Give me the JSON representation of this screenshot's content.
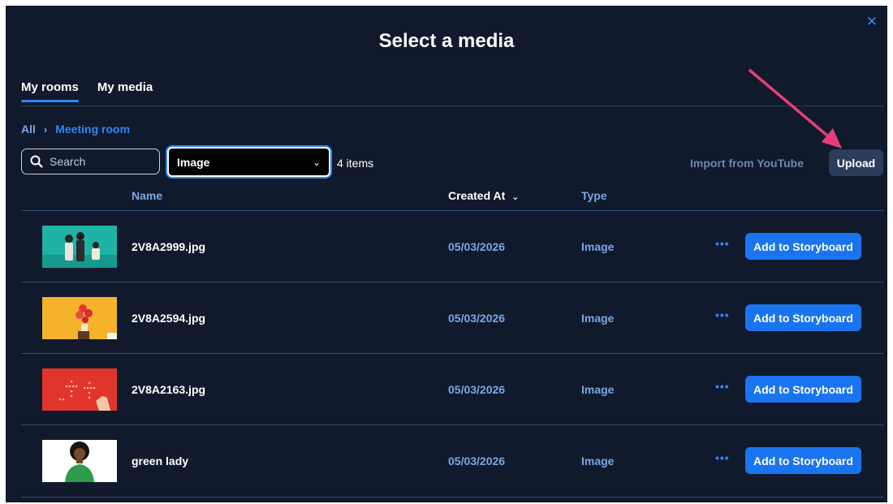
{
  "dialog": {
    "title": "Select a media",
    "close_icon": "close-icon"
  },
  "tabs": [
    {
      "label": "My rooms",
      "active": true
    },
    {
      "label": "My media",
      "active": false
    }
  ],
  "breadcrumb": {
    "root": "All",
    "separator": "›",
    "current": "Meeting room"
  },
  "search": {
    "placeholder": "Search"
  },
  "filter": {
    "selected": "Image"
  },
  "item_count": "4 items",
  "actions": {
    "import_youtube": "Import from YouTube",
    "upload": "Upload"
  },
  "table": {
    "columns": {
      "name": "Name",
      "created": "Created At",
      "type": "Type"
    },
    "rows": [
      {
        "name": "2V8A2999.jpg",
        "date": "05/03/2026",
        "type": "Image",
        "more": "•••",
        "action": "Add to Storyboard"
      },
      {
        "name": "2V8A2594.jpg",
        "date": "05/03/2026",
        "type": "Image",
        "more": "•••",
        "action": "Add to Storyboard"
      },
      {
        "name": "2V8A2163.jpg",
        "date": "05/03/2026",
        "type": "Image",
        "more": "•••",
        "action": "Add to Storyboard"
      },
      {
        "name": "green lady",
        "date": "05/03/2026",
        "type": "Image",
        "more": "•••",
        "action": "Add to Storyboard"
      }
    ]
  },
  "colors": {
    "background": "#111a2c",
    "accent": "#2f86f6",
    "button": "#1a74f0",
    "annotation_arrow": "#e83e78"
  }
}
